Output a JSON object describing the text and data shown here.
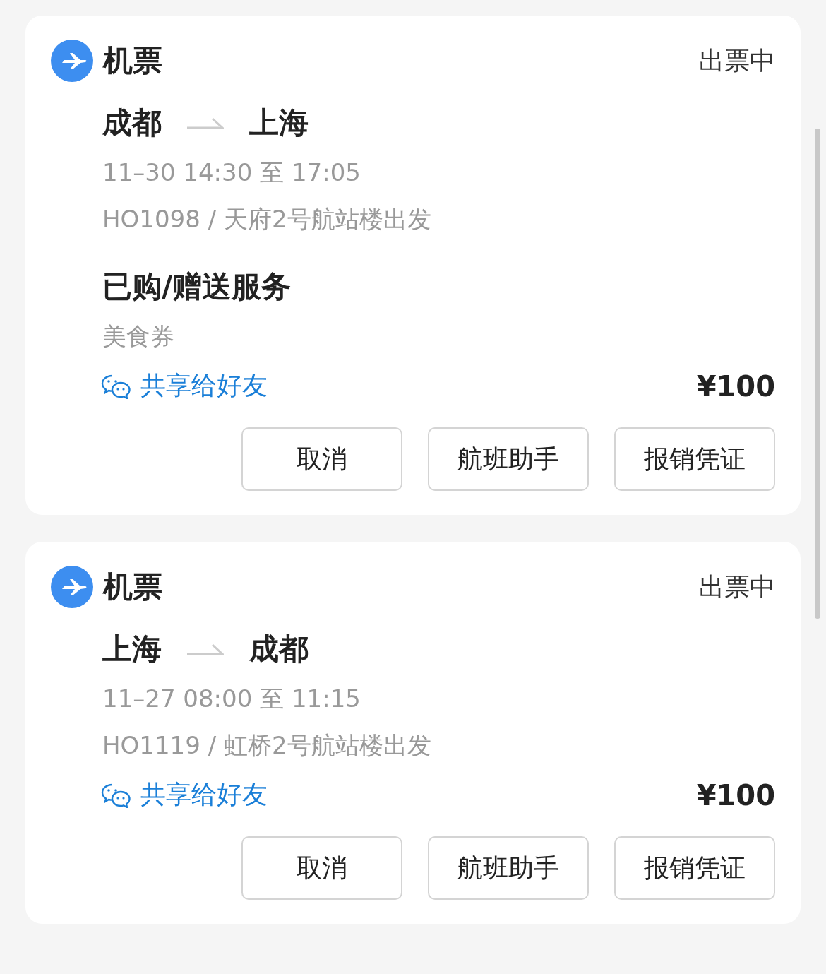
{
  "orders": [
    {
      "category": "机票",
      "status": "出票中",
      "from": "成都",
      "to": "上海",
      "time": "11–30 14:30 至 17:05",
      "flight": "HO1098 / 天府2号航站楼出发",
      "services": {
        "title": "已购/赠送服务",
        "items": [
          "美食券"
        ]
      },
      "share": "共享给好友",
      "price": "¥100",
      "buttons": [
        "取消",
        "航班助手",
        "报销凭证"
      ]
    },
    {
      "category": "机票",
      "status": "出票中",
      "from": "上海",
      "to": "成都",
      "time": "11–27 08:00 至 11:15",
      "flight": "HO1119 / 虹桥2号航站楼出发",
      "share": "共享给好友",
      "price": "¥100",
      "buttons": [
        "取消",
        "航班助手",
        "报销凭证"
      ]
    }
  ]
}
